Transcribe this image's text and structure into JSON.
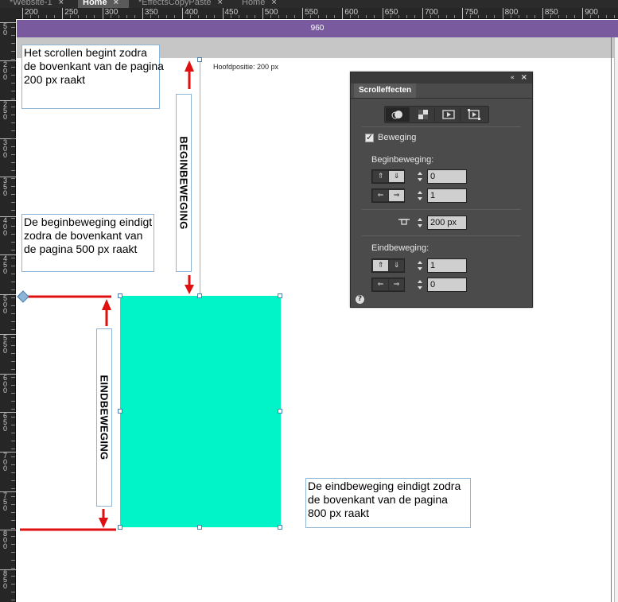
{
  "tabs": [
    {
      "label": "*Website-1",
      "active": false
    },
    {
      "label": "Home",
      "active": true
    },
    {
      "label": "*EffectsCopyPaste",
      "active": false
    },
    {
      "label": "Home",
      "active": false
    }
  ],
  "ruler": {
    "h_ticks": [
      "200",
      "250",
      "300",
      "350",
      "400",
      "450",
      "500",
      "550",
      "600",
      "650",
      "700",
      "750",
      "800",
      "850",
      "900"
    ],
    "v_ticks": [
      "50",
      "200",
      "250",
      "300",
      "350",
      "400",
      "450",
      "500",
      "550",
      "600",
      "650",
      "700",
      "750",
      "800",
      "850"
    ]
  },
  "page_width_label": "960",
  "annotations": {
    "scroll_start": [
      "Het scrollen begint zodra",
      "de bovenkant van de pagina",
      "200 px raakt"
    ],
    "begin_end": [
      "De beginbeweging eindigt",
      "zodra de bovenkant van",
      "de pagina 500 px raakt"
    ],
    "end_end": [
      "De eindbeweging eindigt zodra",
      "de bovenkant van de pagina",
      "800 px raakt"
    ],
    "begin_label": "BEGINBEWEGING",
    "end_label": "EINDBEWEGING",
    "hoofdpositie": "Hoofdpositie:  200 px"
  },
  "colors": {
    "teal": "#00f4c8",
    "purple_bar": "#7a5a9e",
    "arrow_red": "#e01010"
  },
  "panel": {
    "title": "Scrolleffecten",
    "collapse_icon": "«",
    "close_icon": "×",
    "modes": [
      "motion-icon",
      "opacity-icon",
      "slideshow-icon",
      "adobe-edge-icon"
    ],
    "beweging_label": "Beweging",
    "beweging_checked": true,
    "begin_label": "Beginbeweging:",
    "begin_vertical": "0",
    "begin_horizontal": "1",
    "key_position": "200 px",
    "end_label": "Eindbeweging:",
    "end_vertical": "1",
    "end_horizontal": "0",
    "help_icon": "?"
  }
}
